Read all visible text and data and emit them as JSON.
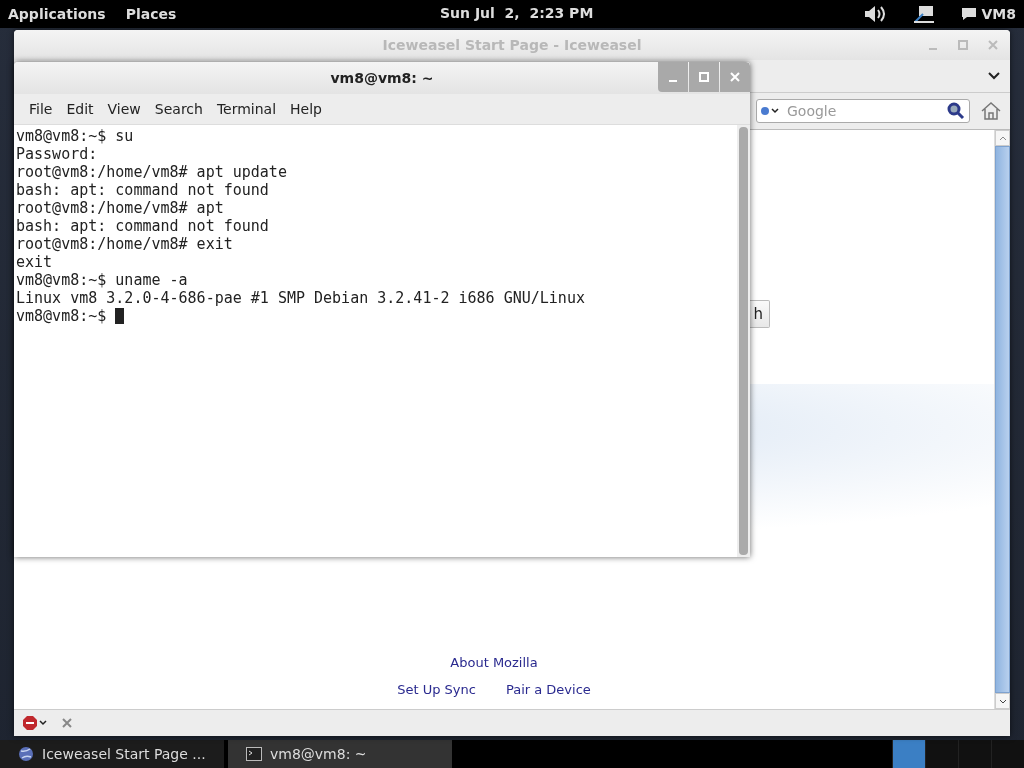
{
  "top_bar": {
    "menus": [
      "Applications",
      "Places"
    ],
    "clock": "Sun Jul  2,  2:23 PM",
    "user": "VM8"
  },
  "browser": {
    "title": "Iceweasel Start Page - Iceweasel",
    "active": false,
    "search": {
      "placeholder": "Google"
    },
    "button": "h",
    "links": [
      [
        "About Mozilla"
      ],
      [
        "Set Up Sync",
        "Pair a Device"
      ]
    ]
  },
  "terminal": {
    "title": "vm8@vm8: ~",
    "active": true,
    "menus": [
      "File",
      "Edit",
      "View",
      "Search",
      "Terminal",
      "Help"
    ],
    "cursor": true,
    "lines": [
      "vm8@vm8:~$ su",
      "Password:",
      "root@vm8:/home/vm8# apt update",
      "bash: apt: command not found",
      "root@vm8:/home/vm8# apt",
      "bash: apt: command not found",
      "root@vm8:/home/vm8# exit",
      "exit",
      "vm8@vm8:~$ uname -a",
      "Linux vm8 3.2.0-4-686-pae #1 SMP Debian 3.2.41-2 i686 GNU/Linux",
      "vm8@vm8:~$ "
    ]
  },
  "taskbar": {
    "tasks": [
      {
        "kind": "browser",
        "label": "Iceweasel Start Page ...",
        "selected": false
      },
      {
        "kind": "terminal",
        "label": "vm8@vm8: ~",
        "selected": true
      }
    ],
    "workspaces": [
      {
        "selected": true
      },
      {
        "selected": false
      },
      {
        "selected": false
      },
      {
        "selected": false
      }
    ]
  }
}
